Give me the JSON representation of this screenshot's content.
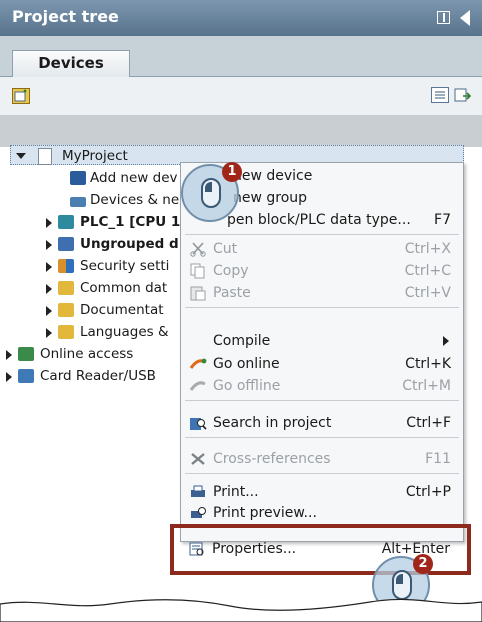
{
  "panel": {
    "title": "Project tree",
    "tab": "Devices"
  },
  "tree": {
    "items": [
      {
        "label": "MyProject",
        "level": 0
      },
      {
        "label": "Add new dev",
        "level": 1
      },
      {
        "label": "Devices & ne",
        "level": 1
      },
      {
        "label": "PLC_1 [CPU 1",
        "level": 1
      },
      {
        "label": "Ungrouped d",
        "level": 1
      },
      {
        "label": "Security setti",
        "level": 1
      },
      {
        "label": "Common dat",
        "level": 1
      },
      {
        "label": "Documentat",
        "level": 1
      },
      {
        "label": "Languages &",
        "level": 1
      },
      {
        "label": "Online access",
        "level": 0
      },
      {
        "label": "Card Reader/USB",
        "level": 0
      }
    ]
  },
  "context_menu": {
    "items": [
      {
        "label": "new device",
        "shortcut": ""
      },
      {
        "label": "new group",
        "shortcut": ""
      },
      {
        "label": "pen block/PLC data type...",
        "shortcut": "F7"
      },
      {
        "label": "Cut",
        "shortcut": "Ctrl+X"
      },
      {
        "label": "Copy",
        "shortcut": "Ctrl+C"
      },
      {
        "label": "Paste",
        "shortcut": "Ctrl+V"
      },
      {
        "label": "Compile",
        "shortcut": ""
      },
      {
        "label": "Go online",
        "shortcut": "Ctrl+K"
      },
      {
        "label": "Go offline",
        "shortcut": "Ctrl+M"
      },
      {
        "label": "Search in project",
        "shortcut": "Ctrl+F"
      },
      {
        "label": "Cross-references",
        "shortcut": "F11"
      },
      {
        "label": "Print...",
        "shortcut": "Ctrl+P"
      },
      {
        "label": "Print preview...",
        "shortcut": ""
      },
      {
        "label": "Properties...",
        "shortcut": "Alt+Enter"
      }
    ]
  },
  "callouts": {
    "step1": "1",
    "step2": "2"
  },
  "colors": {
    "title_bar": "#6a859e",
    "highlight": "#8c2a1d",
    "badge": "#a0261a"
  }
}
